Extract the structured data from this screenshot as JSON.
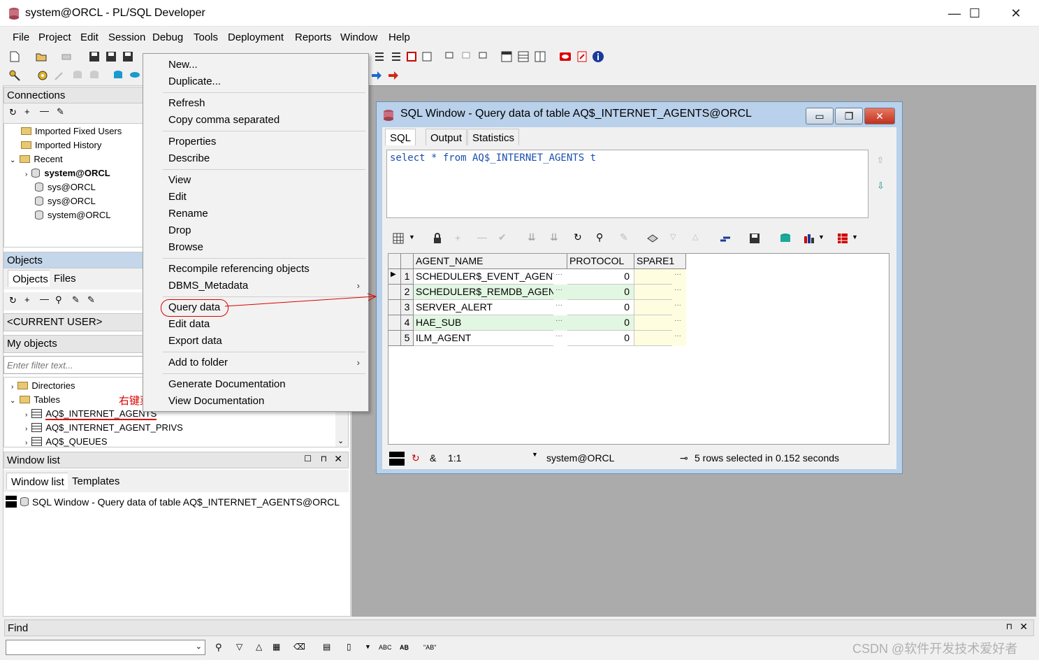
{
  "window": {
    "title": "system@ORCL - PL/SQL Developer",
    "minimize": "—",
    "maximize": "☐",
    "close": "✕"
  },
  "menu": [
    "File",
    "Project",
    "Edit",
    "Session",
    "Debug",
    "Tools",
    "Deployment",
    "Reports",
    "Window",
    "Help"
  ],
  "connections": {
    "header": "Connections",
    "items": [
      {
        "label": "Imported Fixed Users",
        "type": "folder"
      },
      {
        "label": "Imported History",
        "type": "folder"
      },
      {
        "label": "Recent",
        "type": "folder"
      },
      {
        "label": "system@ORCL",
        "type": "db",
        "bold": true
      },
      {
        "label": "sys@ORCL",
        "type": "db"
      },
      {
        "label": "sys@ORCL",
        "type": "db"
      },
      {
        "label": "system@ORCL",
        "type": "db"
      }
    ]
  },
  "objects": {
    "header": "Objects",
    "tabs": [
      "Objects",
      "Files"
    ],
    "user_selector": "<CURRENT USER>",
    "filter_selector": "My objects",
    "filter_placeholder": "Enter filter text...",
    "tree": [
      {
        "label": "Directories",
        "type": "folder"
      },
      {
        "label": "Tables",
        "type": "folder"
      },
      {
        "label": "AQ$_INTERNET_AGENTS",
        "type": "table"
      },
      {
        "label": "AQ$_INTERNET_AGENT_PRIVS",
        "type": "table"
      },
      {
        "label": "AQ$_QUEUES",
        "type": "table"
      }
    ],
    "annotation": "右键菜单"
  },
  "window_list": {
    "header": "Window list",
    "tabs": [
      "Window list",
      "Templates"
    ],
    "entry": "SQL Window - Query data of table AQ$_INTERNET_AGENTS@ORCL"
  },
  "context_menu": {
    "items": [
      "New...",
      "Duplicate...",
      "Refresh",
      "Copy comma separated",
      "Properties",
      "Describe",
      "View",
      "Edit",
      "Rename",
      "Drop",
      "Browse",
      "Recompile referencing objects",
      "DBMS_Metadata",
      "Query data",
      "Edit data",
      "Export data",
      "Add to folder",
      "Generate Documentation",
      "View Documentation"
    ],
    "submenu_arrow": "›"
  },
  "sql_window": {
    "title": "SQL Window - Query data of table AQ$_INTERNET_AGENTS@ORCL",
    "tabs": [
      "SQL",
      "Output",
      "Statistics"
    ],
    "query": "select * from AQ$_INTERNET_AGENTS t",
    "grid": {
      "columns": [
        "AGENT_NAME",
        "PROTOCOL",
        "SPARE1"
      ],
      "rows": [
        {
          "num": "1",
          "agent_name": "SCHEDULER$_EVENT_AGENT",
          "protocol": "0",
          "spare1": ""
        },
        {
          "num": "2",
          "agent_name": "SCHEDULER$_REMDB_AGENT",
          "protocol": "0",
          "spare1": ""
        },
        {
          "num": "3",
          "agent_name": "SERVER_ALERT",
          "protocol": "0",
          "spare1": ""
        },
        {
          "num": "4",
          "agent_name": "HAE_SUB",
          "protocol": "0",
          "spare1": ""
        },
        {
          "num": "5",
          "agent_name": "ILM_AGENT",
          "protocol": "0",
          "spare1": ""
        }
      ],
      "ellipsis": "···"
    },
    "status": {
      "ampersand": "&",
      "position": "1:1",
      "connection": "system@ORCL",
      "message": "5 rows selected in 0.152 seconds"
    }
  },
  "find": {
    "header": "Find",
    "input_value": ""
  },
  "watermark": "CSDN @软件开发技术爱好者",
  "colors": {
    "row_even_bg": "#e2f7e2",
    "spare1_bg": "#fffde0",
    "annotation_red": "#d00000",
    "active_header": "#c3d6ea"
  }
}
